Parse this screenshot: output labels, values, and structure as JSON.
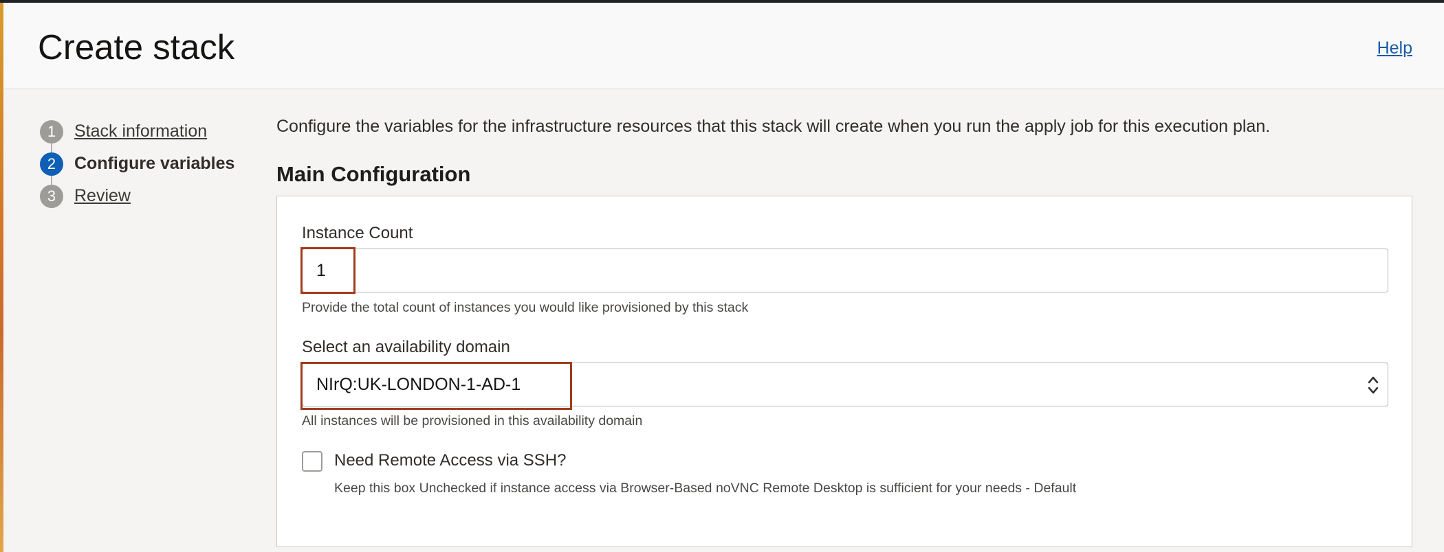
{
  "header": {
    "title": "Create stack",
    "help_label": "Help"
  },
  "steps": [
    {
      "number": "1",
      "label": "Stack information",
      "active": false
    },
    {
      "number": "2",
      "label": "Configure variables",
      "active": true
    },
    {
      "number": "3",
      "label": "Review",
      "active": false
    }
  ],
  "intro_text": "Configure the variables for the infrastructure resources that this stack will create when you run the apply job for this execution plan.",
  "section_title": "Main Configuration",
  "form": {
    "instance_count": {
      "label": "Instance Count",
      "value": "1",
      "hint": "Provide the total count of instances you would like provisioned by this stack"
    },
    "availability_domain": {
      "label": "Select an availability domain",
      "value": "NIrQ:UK-LONDON-1-AD-1",
      "hint": "All instances will be provisioned in this availability domain"
    },
    "ssh_access": {
      "label": "Need Remote Access via SSH?",
      "checked": false,
      "hint": "Keep this box Unchecked if instance access via Browser-Based noVNC Remote Desktop is sufficient for your needs - Default"
    }
  },
  "icons": {
    "select_arrow": "chevron-up-down-icon"
  },
  "colors": {
    "accent": "#0e5fb6",
    "highlight": "#a13b1a",
    "link": "#1a5aa6"
  }
}
